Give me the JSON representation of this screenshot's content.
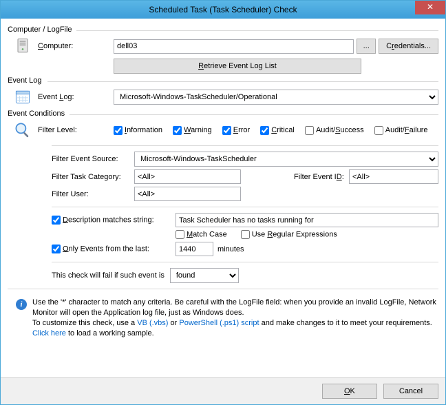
{
  "window": {
    "title": "Scheduled Task (Task Scheduler) Check"
  },
  "groups": {
    "computer": "Computer / LogFile",
    "eventlog": "Event Log",
    "conditions": "Event Conditions"
  },
  "computer": {
    "label": "Computer:",
    "value": "dell03",
    "browse": "...",
    "credentials": "Credentials...",
    "retrieve": "Retrieve Event Log List"
  },
  "eventlog": {
    "label": "Event Log:",
    "value": "Microsoft-Windows-TaskScheduler/Operational"
  },
  "conditions": {
    "filterlevel_label": "Filter Level:",
    "levels": {
      "information": {
        "label": "Information",
        "checked": true
      },
      "warning": {
        "label": "Warning",
        "checked": true
      },
      "error": {
        "label": "Error",
        "checked": true
      },
      "critical": {
        "label": "Critical",
        "checked": true
      },
      "auditsuccess": {
        "label": "Audit/Success",
        "checked": false
      },
      "auditfailure": {
        "label": "Audit/Failure",
        "checked": false
      }
    },
    "source_label": "Filter Event Source:",
    "source_value": "Microsoft-Windows-TaskScheduler",
    "taskcat_label": "Filter Task Category:",
    "taskcat_value": "<All>",
    "eventid_label": "Filter Event ID:",
    "eventid_value": "<All>",
    "user_label": "Filter User:",
    "user_value": "<All>",
    "desc_checked": true,
    "desc_label": "Description matches string:",
    "desc_value": "Task Scheduler has no tasks running for",
    "matchcase": {
      "label": "Match Case",
      "checked": false
    },
    "regex": {
      "label": "Use Regular Expressions",
      "checked": false
    },
    "onlylast_checked": true,
    "onlylast_label": "Only Events from the last:",
    "onlylast_value": "1440",
    "onlylast_unit": "minutes",
    "fail_prefix": "This check will fail if such event is",
    "fail_value": "found"
  },
  "info": {
    "l1a": "Use the '*' character to match any criteria. Be careful with the LogFile field: when you provide an invalid LogFile, Network",
    "l1b": "Monitor will open the Application log file, just as Windows does.",
    "l2a": "To customize this check, use a ",
    "l2b": "VB (.vbs)",
    "l2c": "   or ",
    "l2d": "PowerShell (.ps1) script",
    "l2e": " and make changes to it to meet your requirements.",
    "l3a": "Click here",
    "l3b": " to load a working sample."
  },
  "buttons": {
    "ok": "OK",
    "cancel": "Cancel"
  }
}
